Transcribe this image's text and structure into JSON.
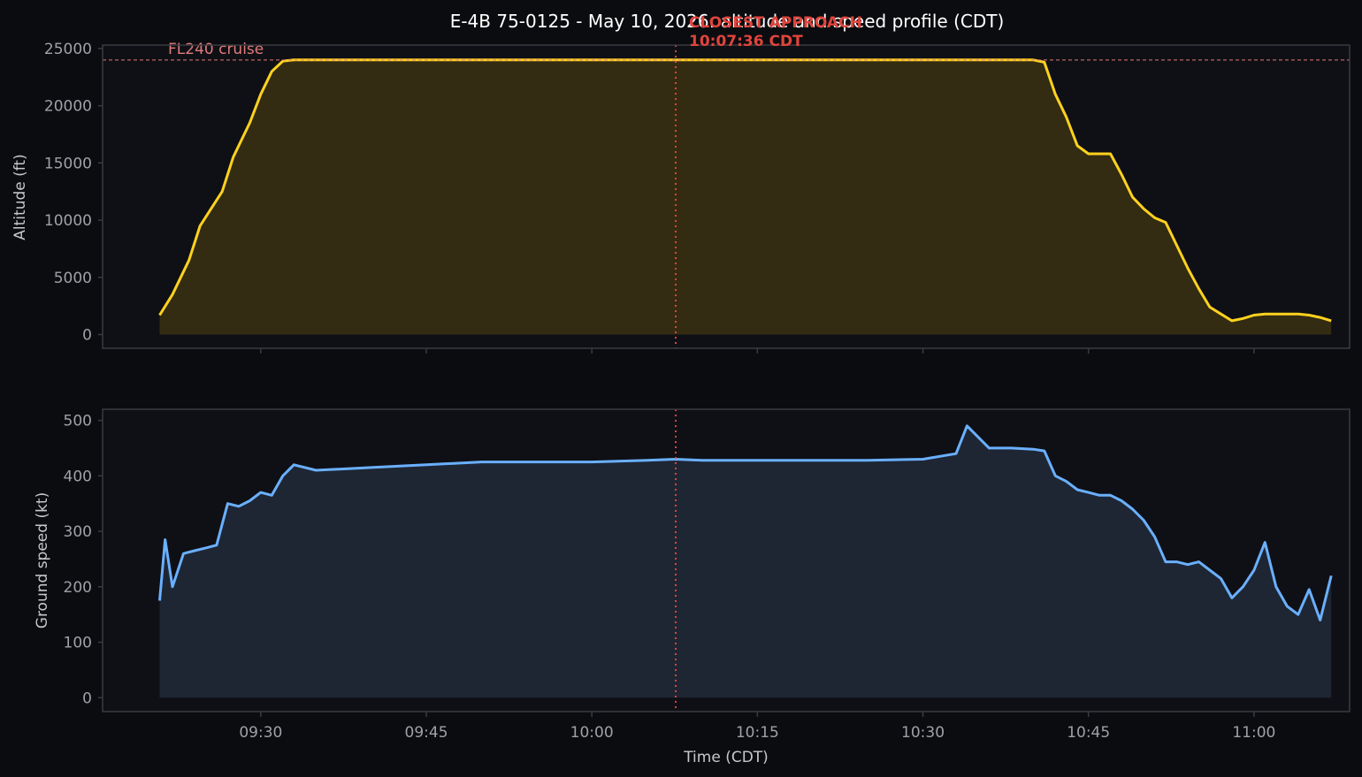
{
  "figure": {
    "title": "E-4B 75-0125 - May 10, 2026: altitude and speed profile (CDT)",
    "colors": {
      "background": "#0b0c0f",
      "panel": "#0f1015",
      "frame": "#3a3b42",
      "tick_text": "#a0a0a8",
      "label_text": "#c8c8cc",
      "title_text": "#ffffff"
    }
  },
  "annotation": {
    "line1": "CLOSEST APPROACH",
    "line2": "10:07:36 CDT",
    "time": "10:07:36",
    "color": "#e0443c"
  },
  "xaxis": {
    "label": "Time (CDT)",
    "ticks": [
      "09:30",
      "09:45",
      "10:00",
      "10:15",
      "10:30",
      "10:45",
      "11:00"
    ],
    "range": [
      "09:15:40",
      "11:08:40"
    ]
  },
  "chart_data": [
    {
      "type": "area",
      "ylabel": "Altitude (ft)",
      "ylim": [
        -1200,
        25300
      ],
      "yticks": [
        0,
        5000,
        10000,
        15000,
        20000,
        25000
      ],
      "color": "#ffd21f",
      "fill": "#332c12",
      "reference_line": {
        "y": 24000,
        "label": "FL240 cruise",
        "color": "#e07a7a"
      },
      "x": [
        "09:20:50",
        "09:22:00",
        "09:23:30",
        "09:24:30",
        "09:25:30",
        "09:26:30",
        "09:27:30",
        "09:28:30",
        "09:29:00",
        "09:30:00",
        "09:31:00",
        "09:32:00",
        "09:33:00",
        "09:34:30",
        "09:36:00",
        "09:40:00",
        "09:50:00",
        "10:00:00",
        "10:10:00",
        "10:20:00",
        "10:30:00",
        "10:40:00",
        "10:41:00",
        "10:42:00",
        "10:43:00",
        "10:44:00",
        "10:45:00",
        "10:46:00",
        "10:47:00",
        "10:48:00",
        "10:49:00",
        "10:50:00",
        "10:51:00",
        "10:52:00",
        "10:53:00",
        "10:54:00",
        "10:55:00",
        "10:56:00",
        "10:57:00",
        "10:58:00",
        "10:59:00",
        "11:00:00",
        "11:01:00",
        "11:02:00",
        "11:03:00",
        "11:04:00",
        "11:05:00",
        "11:06:00",
        "11:07:00"
      ],
      "y": [
        1700,
        3500,
        6500,
        9500,
        11000,
        12500,
        15500,
        17500,
        18500,
        21000,
        23000,
        23900,
        24000,
        24000,
        24000,
        24000,
        24000,
        24000,
        24000,
        24000,
        24000,
        24000,
        23800,
        21000,
        19000,
        16500,
        15800,
        15800,
        15800,
        14000,
        12000,
        11000,
        10200,
        9800,
        7800,
        5800,
        4000,
        2400,
        1800,
        1200,
        1400,
        1700,
        1800,
        1800,
        1800,
        1800,
        1700,
        1500,
        1200
      ]
    },
    {
      "type": "area",
      "ylabel": "Ground speed (kt)",
      "ylim": [
        -25,
        520
      ],
      "yticks": [
        0,
        100,
        200,
        300,
        400,
        500
      ],
      "color": "#6ab0ff",
      "fill": "#1e2634",
      "x": [
        "09:20:50",
        "09:21:20",
        "09:22:00",
        "09:23:00",
        "09:24:00",
        "09:25:00",
        "09:26:00",
        "09:27:00",
        "09:28:00",
        "09:29:00",
        "09:30:00",
        "09:31:00",
        "09:32:00",
        "09:33:00",
        "09:35:00",
        "09:40:00",
        "09:45:00",
        "09:50:00",
        "09:55:00",
        "10:00:00",
        "10:05:00",
        "10:07:36",
        "10:10:00",
        "10:15:00",
        "10:20:00",
        "10:25:00",
        "10:30:00",
        "10:33:00",
        "10:34:00",
        "10:36:00",
        "10:38:00",
        "10:40:00",
        "10:41:00",
        "10:42:00",
        "10:43:00",
        "10:44:00",
        "10:45:00",
        "10:46:00",
        "10:47:00",
        "10:48:00",
        "10:49:00",
        "10:50:00",
        "10:51:00",
        "10:52:00",
        "10:53:00",
        "10:54:00",
        "10:55:00",
        "10:56:00",
        "10:57:00",
        "10:58:00",
        "10:59:00",
        "11:00:00",
        "11:01:00",
        "11:02:00",
        "11:03:00",
        "11:04:00",
        "11:05:00",
        "11:06:00",
        "11:07:00"
      ],
      "y": [
        175,
        285,
        200,
        260,
        265,
        270,
        275,
        350,
        345,
        355,
        370,
        365,
        400,
        420,
        410,
        415,
        420,
        425,
        425,
        425,
        428,
        430,
        428,
        428,
        428,
        428,
        430,
        440,
        490,
        450,
        450,
        448,
        445,
        400,
        390,
        375,
        370,
        365,
        365,
        355,
        340,
        320,
        290,
        245,
        245,
        240,
        245,
        230,
        215,
        180,
        200,
        230,
        280,
        200,
        165,
        150,
        195,
        140,
        220
      ]
    }
  ]
}
